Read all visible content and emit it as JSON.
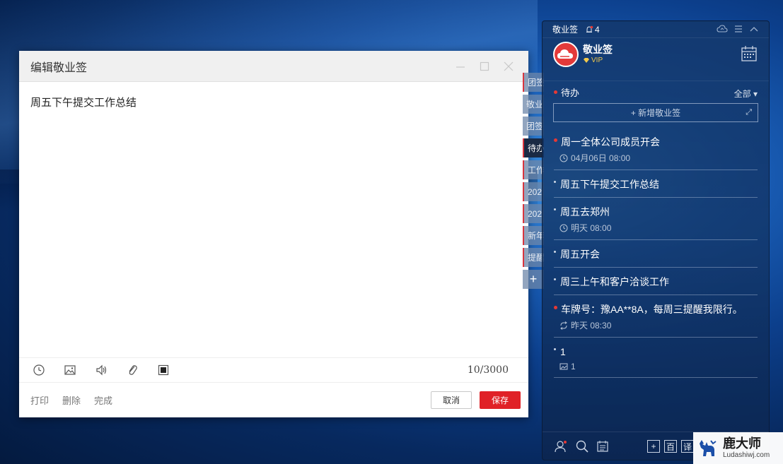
{
  "editor": {
    "title": "编辑敬业签",
    "content": "周五下午提交工作总结",
    "char_count": "10/3000",
    "toolbar_icons": [
      "clock-icon",
      "image-icon",
      "speaker-icon",
      "attachment-icon",
      "stop-icon"
    ],
    "footer": {
      "print": "打印",
      "delete": "删除",
      "done": "完成",
      "cancel": "取消",
      "save": "保存"
    }
  },
  "side_tabs": [
    "团签",
    "敬业",
    "团签",
    "待办",
    "工作",
    "202",
    "202",
    "新年",
    "提醒"
  ],
  "side_tab_add": "+",
  "panel": {
    "app_title": "敬业签",
    "bell_count": "4",
    "app_name": "敬业签",
    "vip_label": "VIP",
    "section_title": "待办",
    "filter_label": "全部",
    "new_note_placeholder": "+ 新增敬业签",
    "notes": [
      {
        "text": "周一全体公司成员开会",
        "meta": "04月06日 08:00",
        "meta_icon": "clock-icon",
        "dot": "red"
      },
      {
        "text": "周五下午提交工作总结",
        "meta": "",
        "dot": "white"
      },
      {
        "text": "周五去郑州",
        "meta": "明天 08:00",
        "meta_icon": "clock-icon",
        "dot": "white"
      },
      {
        "text": "周五开会",
        "meta": "",
        "dot": "white"
      },
      {
        "text": "周三上午和客户洽谈工作",
        "meta": "",
        "dot": "white"
      },
      {
        "text": "车牌号：豫AA**8A，每周三提醒我限行。",
        "meta": "昨天 08:30",
        "meta_icon": "repeat-icon",
        "dot": "red"
      },
      {
        "text": "1",
        "meta": "1",
        "meta_icon": "image-icon",
        "dot": "white"
      }
    ],
    "bottom_buttons": [
      "+",
      "百",
      "译"
    ]
  },
  "watermark": {
    "cn": "鹿大师",
    "en": "Ludashiwj.com"
  },
  "colors": {
    "accent_red": "#e02127",
    "panel_bg": "#143769"
  }
}
